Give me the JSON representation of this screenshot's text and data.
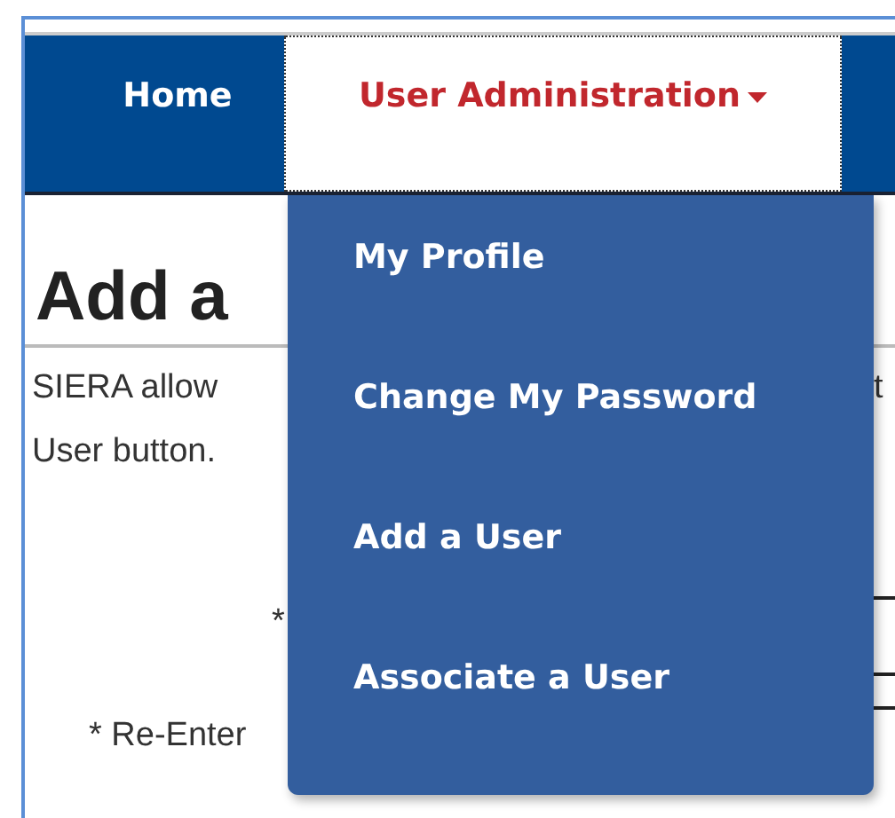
{
  "nav": {
    "items": [
      {
        "label": "Home",
        "selected": false,
        "dropdown": false
      },
      {
        "label": "User Administration",
        "selected": true,
        "dropdown": true
      }
    ]
  },
  "menu": {
    "items": [
      "My Profile",
      "Change My Password",
      "Add a User",
      "Associate a User"
    ]
  },
  "page": {
    "heading": "Add a",
    "intro_left": [
      "SIERA allow",
      "User button."
    ],
    "intro_right": "t",
    "labels": [
      "*",
      "* Re-Enter"
    ]
  }
}
